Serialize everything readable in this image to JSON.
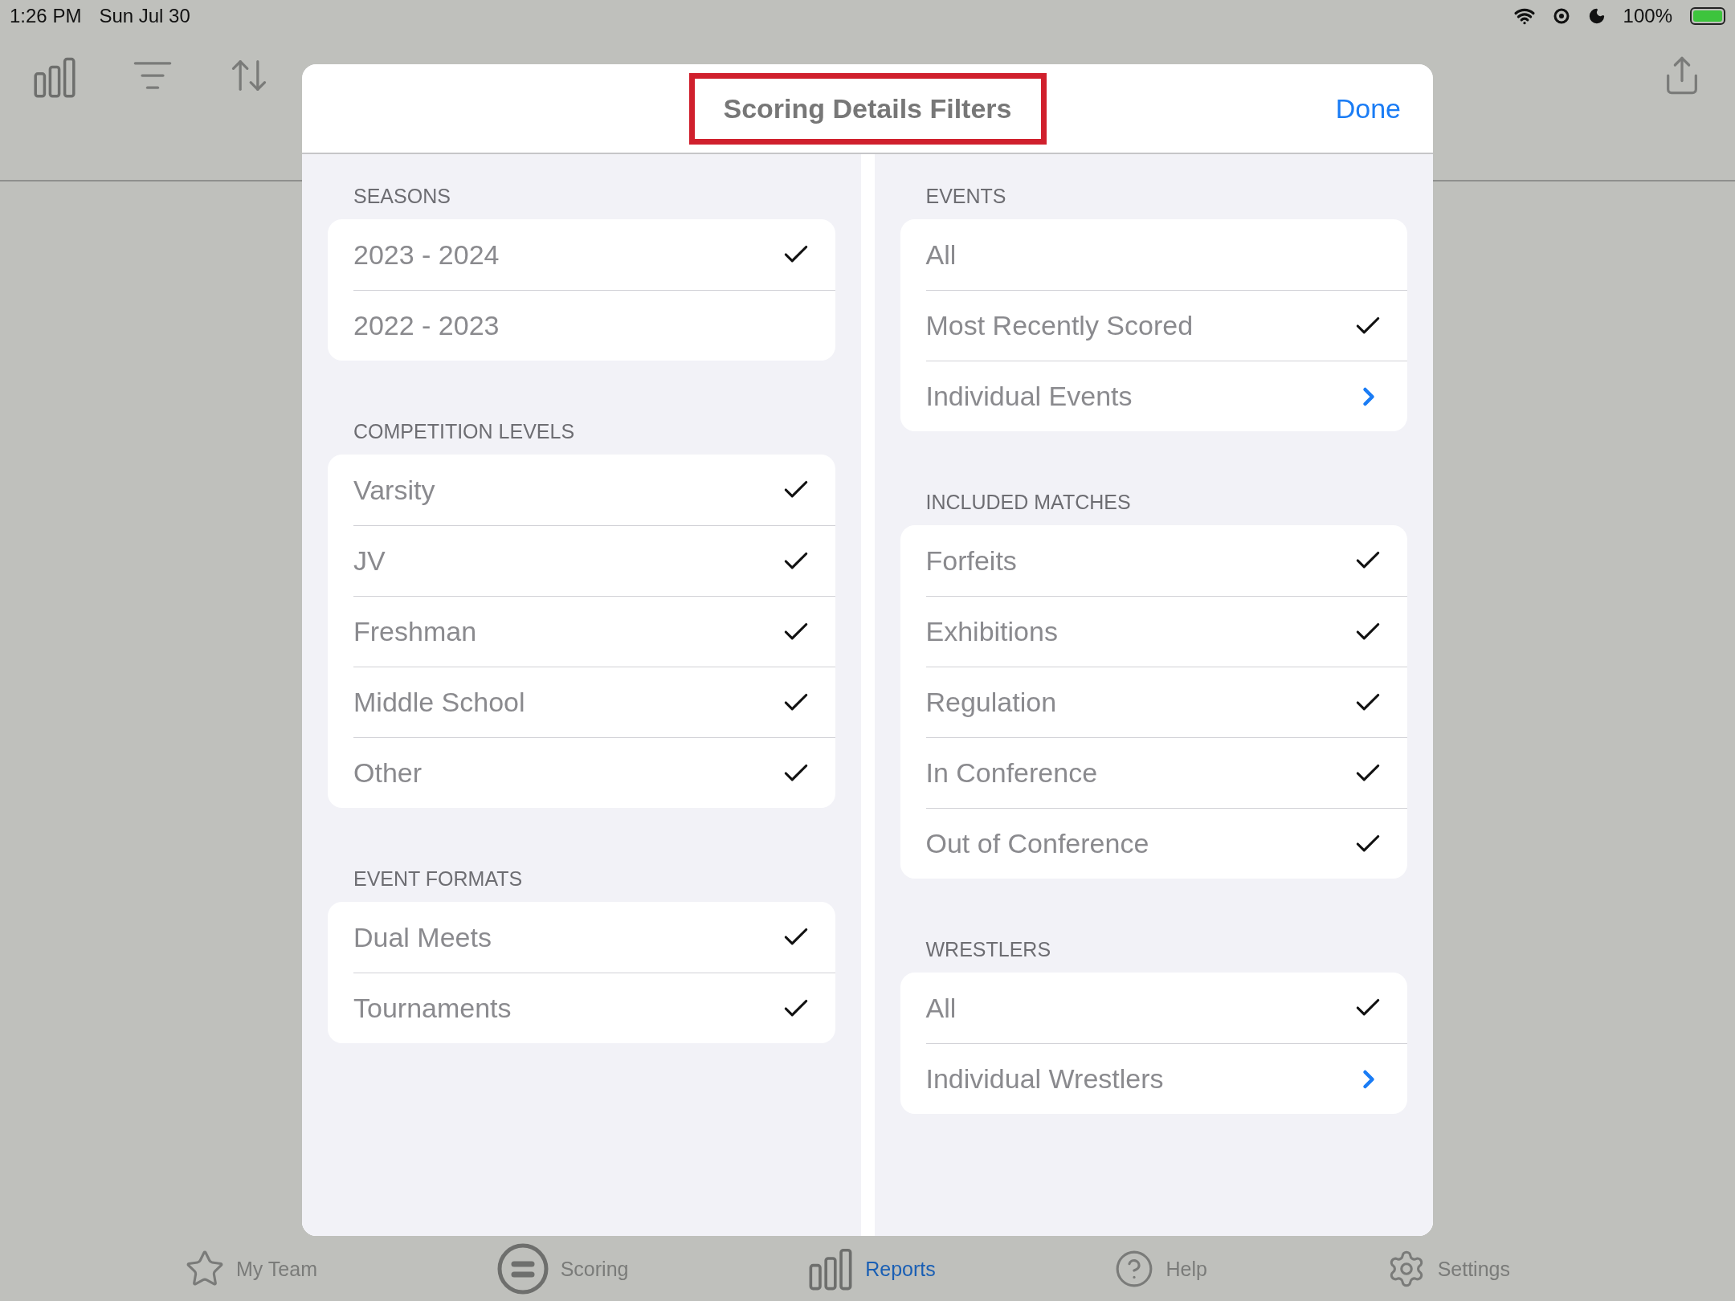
{
  "status_bar": {
    "time": "1:26 PM",
    "date": "Sun Jul 30",
    "battery": "100%"
  },
  "modal": {
    "title": "Scoring Details Filters",
    "title_highlighted": true,
    "done": "Done",
    "columns": [
      {
        "sections": [
          {
            "header": "SEASONS",
            "rows": [
              {
                "label": "2023 - 2024",
                "kind": "check",
                "checked": true
              },
              {
                "label": "2022 - 2023",
                "kind": "check",
                "checked": false
              }
            ]
          },
          {
            "header": "COMPETITION LEVELS",
            "rows": [
              {
                "label": "Varsity",
                "kind": "check",
                "checked": true
              },
              {
                "label": "JV",
                "kind": "check",
                "checked": true
              },
              {
                "label": "Freshman",
                "kind": "check",
                "checked": true
              },
              {
                "label": "Middle School",
                "kind": "check",
                "checked": true
              },
              {
                "label": "Other",
                "kind": "check",
                "checked": true
              }
            ]
          },
          {
            "header": "EVENT FORMATS",
            "rows": [
              {
                "label": "Dual Meets",
                "kind": "check",
                "checked": true
              },
              {
                "label": "Tournaments",
                "kind": "check",
                "checked": true
              }
            ]
          }
        ]
      },
      {
        "sections": [
          {
            "header": "EVENTS",
            "rows": [
              {
                "label": "All",
                "kind": "check",
                "checked": false
              },
              {
                "label": "Most Recently Scored",
                "kind": "check",
                "checked": true
              },
              {
                "label": "Individual Events",
                "kind": "link"
              }
            ]
          },
          {
            "header": "INCLUDED MATCHES",
            "rows": [
              {
                "label": "Forfeits",
                "kind": "check",
                "checked": true
              },
              {
                "label": "Exhibitions",
                "kind": "check",
                "checked": true
              },
              {
                "label": "Regulation",
                "kind": "check",
                "checked": true
              },
              {
                "label": "In Conference",
                "kind": "check",
                "checked": true
              },
              {
                "label": "Out of Conference",
                "kind": "check",
                "checked": true
              }
            ]
          },
          {
            "header": "WRESTLERS",
            "rows": [
              {
                "label": "All",
                "kind": "check",
                "checked": true
              },
              {
                "label": "Individual Wrestlers",
                "kind": "link"
              }
            ]
          }
        ]
      }
    ]
  },
  "tab_bar": [
    {
      "label": "My Team",
      "kind": "star",
      "selected": false
    },
    {
      "label": "Scoring",
      "kind": "scoring",
      "selected": false
    },
    {
      "label": "Reports",
      "kind": "bars",
      "selected": true
    },
    {
      "label": "Help",
      "kind": "help",
      "selected": false
    },
    {
      "label": "Settings",
      "kind": "gear",
      "selected": false
    }
  ]
}
